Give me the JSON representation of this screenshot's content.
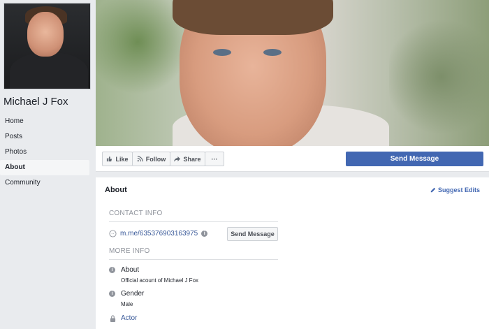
{
  "profile": {
    "name": "Michael J Fox"
  },
  "sidebar": {
    "items": [
      {
        "label": "Home"
      },
      {
        "label": "Posts"
      },
      {
        "label": "Photos"
      },
      {
        "label": "About"
      },
      {
        "label": "Community"
      }
    ],
    "active": "About"
  },
  "actions": {
    "like_label": "Like",
    "follow_label": "Follow",
    "share_label": "Share",
    "more_label": "···",
    "send_message_label": "Send Message"
  },
  "about": {
    "title": "About",
    "suggest_edits": "Suggest Edits",
    "contact_info_header": "CONTACT INFO",
    "messenger_link": "m.me/635376903163975",
    "send_message_label": "Send Message",
    "more_info_header": "MORE INFO",
    "about_label": "About",
    "about_value": "Official acount of Michael J Fox",
    "gender_label": "Gender",
    "gender_value": "Male",
    "category": "Actor"
  },
  "colors": {
    "brand_blue": "#4267b2",
    "link_blue": "#385898",
    "background": "#e9ebee"
  },
  "icons": {
    "like": "thumbs-up-icon",
    "follow": "rss-icon",
    "share": "share-arrow-icon",
    "more": "more-dots-icon",
    "edit": "pencil-icon",
    "messenger": "messenger-icon",
    "info": "info-icon",
    "lock": "lock-icon"
  }
}
